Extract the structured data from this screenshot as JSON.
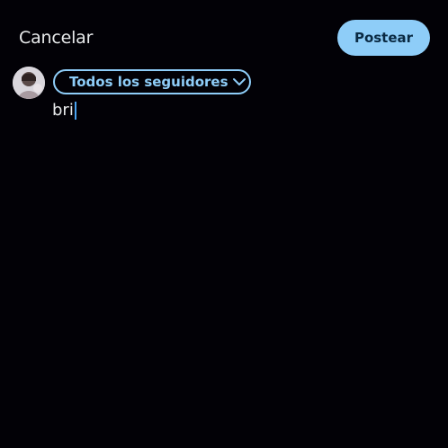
{
  "header": {
    "cancel_label": "Cancelar",
    "post_label": "Postear"
  },
  "audience": {
    "label": "Todos los seguidores",
    "icon": "chevron-down-icon"
  },
  "composer": {
    "text": "bri"
  },
  "user": {
    "avatar_icon": "avatar-photo"
  },
  "colors": {
    "background": "#020106",
    "accent": "#8ecdf8",
    "text": "#e7e9ea",
    "caret": "#4aa3f0"
  }
}
